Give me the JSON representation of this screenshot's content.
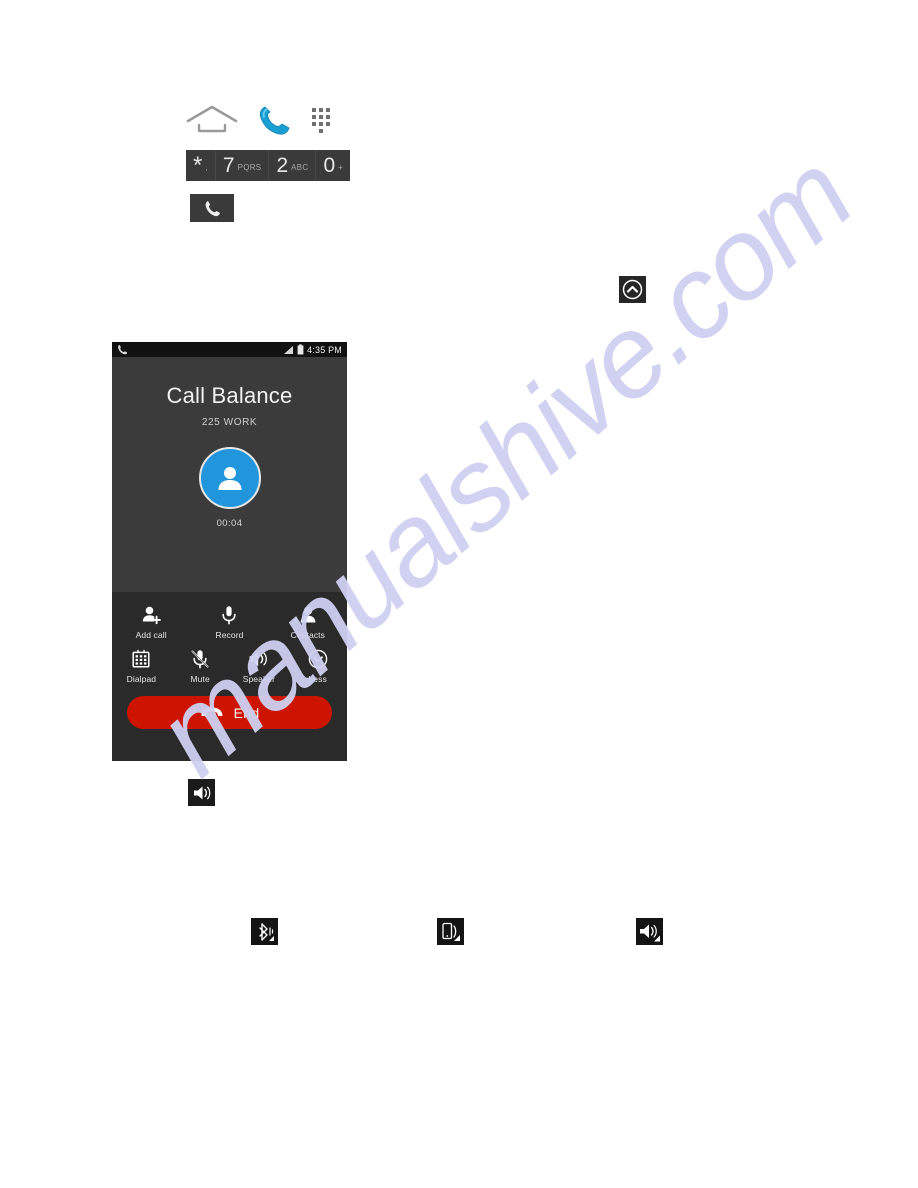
{
  "page": {
    "background": "#ffffff",
    "watermark_text": "manualshive.com",
    "watermark_color": "#cfd0f2"
  },
  "top_icons": {
    "items": [
      {
        "name": "home-icon",
        "label": "Home"
      },
      {
        "name": "phone-handset-icon",
        "label": "Phone"
      },
      {
        "name": "dialpad-grid-icon",
        "label": "Dialpad"
      }
    ]
  },
  "dial_keys": [
    {
      "digit": "*",
      "sub": ","
    },
    {
      "digit": "7",
      "sub": "PQRS"
    },
    {
      "digit": "2",
      "sub": "ABC"
    },
    {
      "digit": "0",
      "sub": "+"
    }
  ],
  "call_chip": {
    "icon": "phone-handset-icon"
  },
  "chevron_chip": {
    "icon": "chevron-up-circle-icon"
  },
  "speaker_chip_mid": {
    "icon": "speaker-on-icon"
  },
  "bottom_chips": [
    {
      "icon": "bluetooth-audio-icon"
    },
    {
      "icon": "handset-audio-icon"
    },
    {
      "icon": "speaker-audio-icon"
    }
  ],
  "phone": {
    "status_bar": {
      "left_icon": "phone-handset-icon",
      "signal_icon": "signal-bars-icon",
      "battery_icon": "battery-icon",
      "clock": "4:35 PM"
    },
    "call": {
      "contact_name": "Call Balance",
      "contact_number": "225 WORK",
      "timer": "00:04",
      "avatar_icon": "person-avatar-icon",
      "avatar_color": "#2196dd"
    },
    "controls_row_1": [
      {
        "label": "Add call",
        "icon": "add-call-icon"
      },
      {
        "label": "Record",
        "icon": "microphone-record-icon"
      },
      {
        "label": "Contacts",
        "icon": "contacts-person-icon"
      }
    ],
    "controls_row_2": [
      {
        "label": "Dialpad",
        "icon": "dialpad-keys-icon"
      },
      {
        "label": "Mute",
        "icon": "microphone-muted-icon"
      },
      {
        "label": "Speaker",
        "icon": "speaker-on-icon"
      },
      {
        "label": "Less",
        "icon": "chevron-down-circle-icon"
      }
    ],
    "end_button": {
      "label": "End",
      "icon": "hangup-handset-icon",
      "color": "#cc1400"
    }
  }
}
